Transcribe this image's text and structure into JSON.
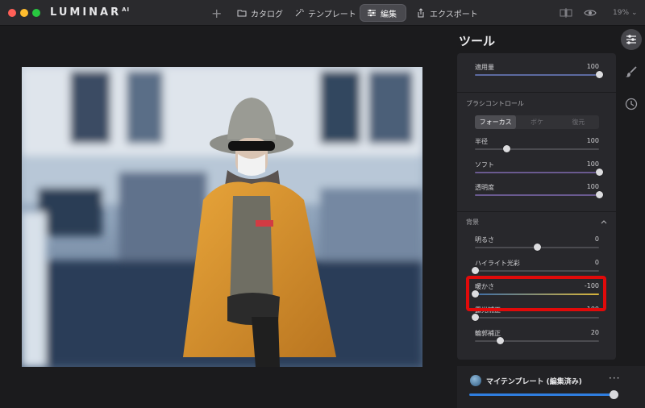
{
  "app": {
    "logo": "LUMINAR",
    "logo_super": "AI"
  },
  "toolbar": {
    "add_label": "+",
    "catalog_label": "カタログ",
    "templates_label": "テンプレート",
    "edit_label": "編集",
    "export_label": "エクスポート",
    "zoom_label": "19%"
  },
  "tools": {
    "title": "ツール",
    "amount": {
      "label": "適用量",
      "value": "100",
      "level": 1.0
    },
    "brush_control": {
      "title": "ブラシコントロール",
      "tabs": [
        "フォーカス",
        "ボケ",
        "復元"
      ],
      "active_tab": "フォーカス",
      "radius": {
        "label": "半径",
        "value": "100",
        "level": 0.25
      },
      "softness": {
        "label": "ソフト",
        "value": "100",
        "level": 1.0
      },
      "opacity": {
        "label": "透明度",
        "value": "100",
        "level": 1.0
      }
    },
    "background": {
      "title": "背景",
      "brightness": {
        "label": "明るさ",
        "value": "0",
        "level": 0.5
      },
      "highlights": {
        "label": "ハイライト光彩",
        "value": "0",
        "level": 0.0
      },
      "warmth": {
        "label": "暖かさ",
        "value": "-100",
        "level": 0.0
      },
      "exposure": {
        "label": "露光補正",
        "value": "-100",
        "level": 0.0
      },
      "edges": {
        "label": "輪郭補正",
        "value": "20",
        "level": 0.2
      }
    }
  },
  "template_bar": {
    "name": "マイテンプレート (編集済み)",
    "more": "···",
    "level": 1.0
  },
  "colors": {
    "accent": "#2f7ee0",
    "highlight": "#e10a0a",
    "warm_track": "#d7b43a",
    "panel": "#28282c"
  }
}
